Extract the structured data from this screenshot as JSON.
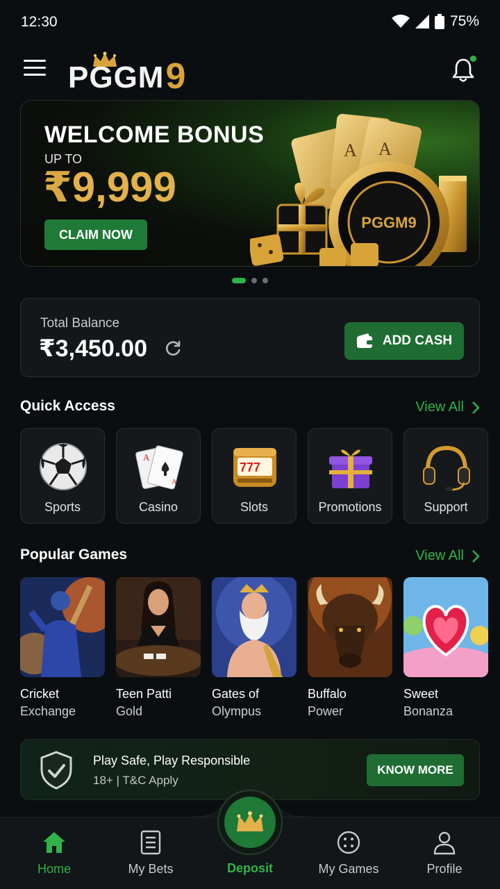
{
  "status_bar": {
    "time": "12:30",
    "battery": "75%"
  },
  "header": {
    "logo_text": "PGGM",
    "logo_digit": "9"
  },
  "banner": {
    "title": "WELCOME BONUS",
    "subtitle": "UP TO",
    "currency": "₹",
    "amount": "9,999",
    "cta": "CLAIM NOW",
    "chip_text": "PGGM9",
    "slides": 3,
    "active_slide": 1
  },
  "balance": {
    "label": "Total Balance",
    "value": "₹3,450.00",
    "add_cash": "ADD CASH"
  },
  "quick_access": {
    "title": "Quick Access",
    "view_all": "View All",
    "items": [
      {
        "label": "Sports",
        "icon": "soccer-ball-icon"
      },
      {
        "label": "Casino",
        "icon": "playing-cards-icon"
      },
      {
        "label": "Slots",
        "icon": "slot-machine-icon"
      },
      {
        "label": "Promotions",
        "icon": "gift-box-icon"
      },
      {
        "label": "Support",
        "icon": "headset-icon"
      }
    ]
  },
  "popular_games": {
    "title": "Popular Games",
    "view_all": "View All",
    "items": [
      {
        "title": "Cricket",
        "subtitle": "Exchange"
      },
      {
        "title": "Teen Patti",
        "subtitle": "Gold"
      },
      {
        "title": "Gates of",
        "subtitle": "Olympus"
      },
      {
        "title": "Buffalo",
        "subtitle": "Power"
      },
      {
        "title": "Sweet",
        "subtitle": "Bonanza"
      }
    ]
  },
  "responsible": {
    "title": "Play Safe, Play Responsible",
    "subtitle": "18+ | T&C Apply",
    "cta": "KNOW MORE"
  },
  "bottom_nav": {
    "items": [
      {
        "label": "Home",
        "icon": "home-icon",
        "active": true
      },
      {
        "label": "My Bets",
        "icon": "bets-slip-icon",
        "active": false
      },
      {
        "label": "Deposit",
        "icon": "crown-icon",
        "active": false
      },
      {
        "label": "My Games",
        "icon": "dice-icon",
        "active": false
      },
      {
        "label": "Profile",
        "icon": "user-icon",
        "active": false
      }
    ]
  },
  "colors": {
    "accent": "#2fb24a",
    "gold": "#e3b24b",
    "background": "#0b0e10",
    "button_green": "#1f6d33"
  }
}
